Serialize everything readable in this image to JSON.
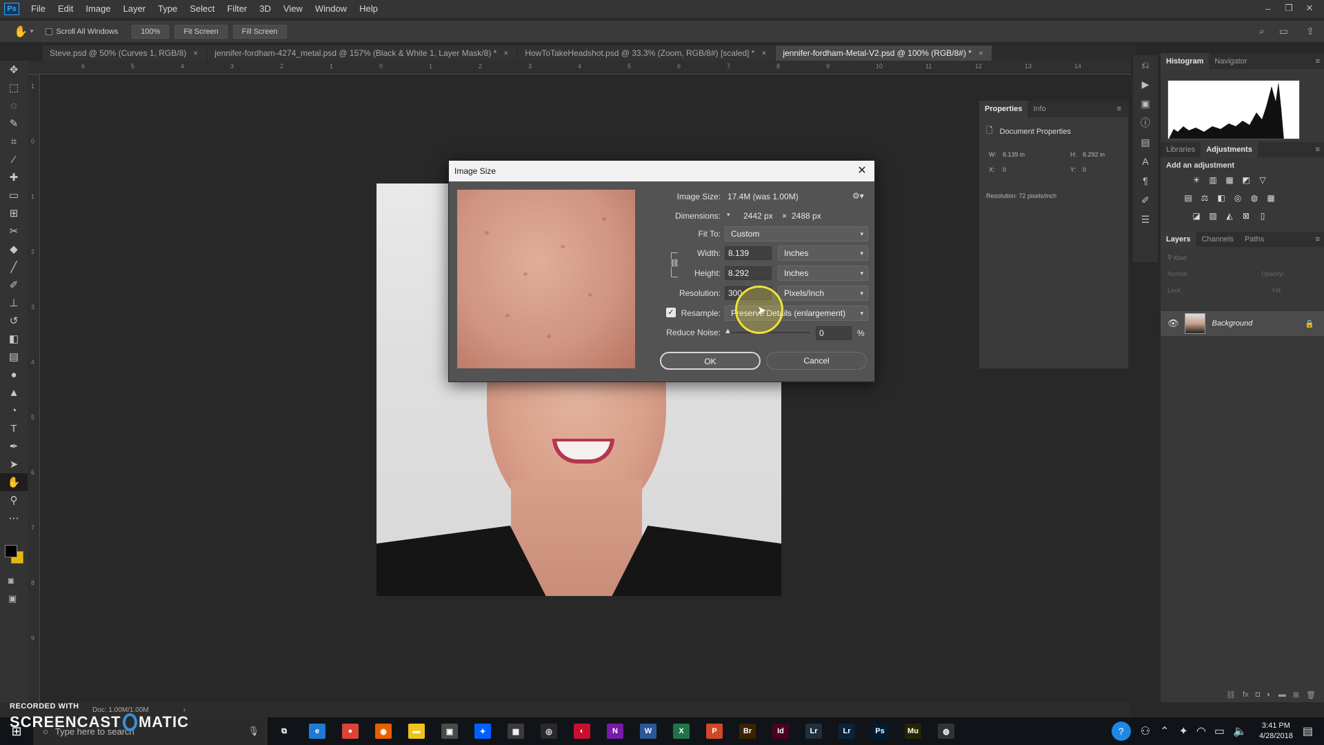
{
  "app": {
    "logo": "Ps"
  },
  "menu": [
    "File",
    "Edit",
    "Image",
    "Layer",
    "Type",
    "Select",
    "Filter",
    "3D",
    "View",
    "Window",
    "Help"
  ],
  "window_controls": [
    "–",
    "❐",
    "✕"
  ],
  "options": {
    "scroll_all_windows": "Scroll All Windows",
    "zoom_100": "100%",
    "fit_screen": "Fit Screen",
    "fill_screen": "Fill Screen"
  },
  "tabs": [
    {
      "label": "Steve.psd @ 50% (Curves 1, RGB/8)",
      "close": "×"
    },
    {
      "label": "jennifer-fordham-4274_metal.psd @ 157% (Black & White 1, Layer Mask/8) *",
      "close": "×"
    },
    {
      "label": "HowToTakeHeadshot.psd @ 33.3% (Zoom, RGB/8#) [scaled] *",
      "close": "×"
    },
    {
      "label": "jennifer-fordham-Metal-V2.psd @ 100% (RGB/8#) *",
      "close": "×"
    }
  ],
  "ruler_top": [
    "6",
    "5",
    "4",
    "3",
    "2",
    "1",
    "0",
    "1",
    "2",
    "3",
    "4",
    "5",
    "6",
    "7",
    "8",
    "9",
    "10",
    "11",
    "12",
    "13",
    "14"
  ],
  "ruler_left": [
    "1",
    "0",
    "1",
    "2",
    "3",
    "4",
    "5",
    "6",
    "7",
    "8",
    "9"
  ],
  "properties": {
    "tabs": [
      "Properties",
      "Info"
    ],
    "heading": "Document Properties",
    "w_label": "W:",
    "w_value": "8.139 in",
    "h_label": "H:",
    "h_value": "8.292 in",
    "x_label": "X:",
    "x_value": "0",
    "y_label": "Y:",
    "y_value": "0",
    "resolution": "Resolution: 72 pixels/inch"
  },
  "dock": {
    "top_tabs": [
      "Histogram",
      "Navigator"
    ],
    "mid_tabs": [
      "Libraries",
      "Adjustments"
    ],
    "add_adjustment": "Add an adjustment",
    "layer_tabs": [
      "Layers",
      "Channels",
      "Paths"
    ],
    "kind": "Kind",
    "blend_mode": "Normal",
    "opacity": "Opacity:",
    "lock": "Lock:",
    "fill": "Fill:",
    "layer_name": "Background"
  },
  "status": {
    "doc": "Doc: 1.00M/1.00M",
    "arrow": "›"
  },
  "watermark": {
    "top": "RECORDED WITH",
    "brand_left": "SCREENCAST",
    "brand_right": "MATIC"
  },
  "taskbar": {
    "search": "Type here to search",
    "apps": [
      {
        "label": "e",
        "color": "#1f7ad6"
      },
      {
        "label": "●",
        "color": "#db4437"
      },
      {
        "label": "◉",
        "color": "#e66000"
      },
      {
        "label": "▬",
        "color": "#f0c419"
      },
      {
        "label": "▣",
        "color": "#4a4a4a"
      },
      {
        "label": "✦",
        "color": "#0061fe"
      },
      {
        "label": "▦",
        "color": "#3a3a3a"
      },
      {
        "label": "◎",
        "color": "#2a2a2a"
      },
      {
        "label": "◐",
        "color": "#c8102e"
      },
      {
        "label": "N",
        "color": "#7719aa"
      },
      {
        "label": "W",
        "color": "#2b579a"
      },
      {
        "label": "X",
        "color": "#217346"
      },
      {
        "label": "P",
        "color": "#d24726"
      },
      {
        "label": "Br",
        "color": "#3b2300"
      },
      {
        "label": "Id",
        "color": "#49021f"
      },
      {
        "label": "Lr",
        "color": "#1f2f3f"
      },
      {
        "label": "Lr",
        "color": "#0b2339"
      },
      {
        "label": "Ps",
        "color": "#001d34"
      },
      {
        "label": "Mu",
        "color": "#262400"
      },
      {
        "label": "◍",
        "color": "#333333"
      }
    ],
    "time": "3:41 PM",
    "date": "4/28/2018"
  },
  "dialog": {
    "title": "Image Size",
    "close": "✕",
    "image_size_label": "Image Size:",
    "image_size_value": "17.4M (was 1.00M)",
    "dimensions_label": "Dimensions:",
    "dim_w": "2442 px",
    "dim_x": "×",
    "dim_h": "2488 px",
    "fit_to_label": "Fit To:",
    "fit_to_value": "Custom",
    "width_label": "Width:",
    "width_value": "8.139",
    "width_unit": "Inches",
    "height_label": "Height:",
    "height_value": "8.292",
    "height_unit": "Inches",
    "resolution_label": "Resolution:",
    "resolution_value": "300",
    "resolution_unit": "Pixels/Inch",
    "resample_label": "Resample:",
    "resample_value": "Preserve Details (enlargement)",
    "reduce_noise_label": "Reduce Noise:",
    "reduce_noise_value": "0",
    "percent": "%",
    "ok": "OK",
    "cancel": "Cancel"
  }
}
